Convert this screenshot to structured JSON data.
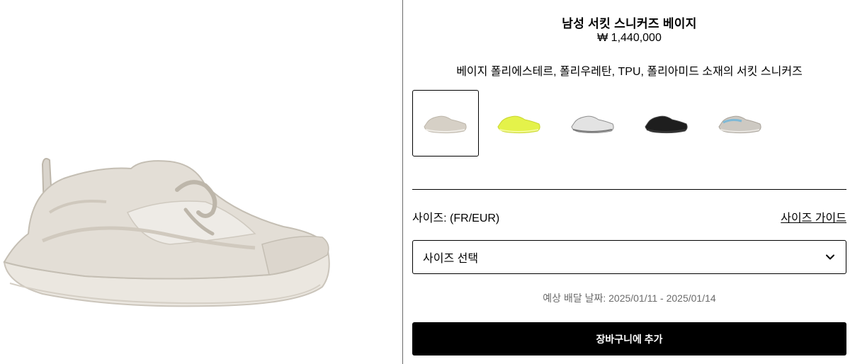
{
  "product": {
    "title": "남성 서킷 스니커즈 베이지",
    "price": "₩ 1,440,000",
    "description": "베이지 폴리에스테르, 폴리우레탄, TPU, 폴리아미드 소재의 서킷 스니커즈",
    "main_image": {
      "name": "beige-circuit-sneaker-image",
      "color": "#d9d4cc"
    }
  },
  "variants": [
    {
      "name": "beige",
      "color": "#d6d0c6",
      "accent": "#bdb6aa",
      "selected": true
    },
    {
      "name": "neon-yellow",
      "color": "#e4f24a",
      "accent": "#c9d62e",
      "selected": false
    },
    {
      "name": "grey",
      "color": "#cfcfcf",
      "accent": "#8f8f8f",
      "selected": false
    },
    {
      "name": "black",
      "color": "#1e1e1e",
      "accent": "#444444",
      "selected": false
    },
    {
      "name": "light-blue-grey",
      "color": "#cdc9c2",
      "accent": "#7fb9d6",
      "selected": false
    }
  ],
  "size": {
    "label": "사이즈: (FR/EUR)",
    "guide_link": "사이즈 가이드",
    "select_placeholder": "사이즈 선택"
  },
  "delivery": {
    "text": "예상 배달 날짜: 2025/01/11 - 2025/01/14"
  },
  "cart": {
    "button_label": "장바구니에 추가"
  }
}
